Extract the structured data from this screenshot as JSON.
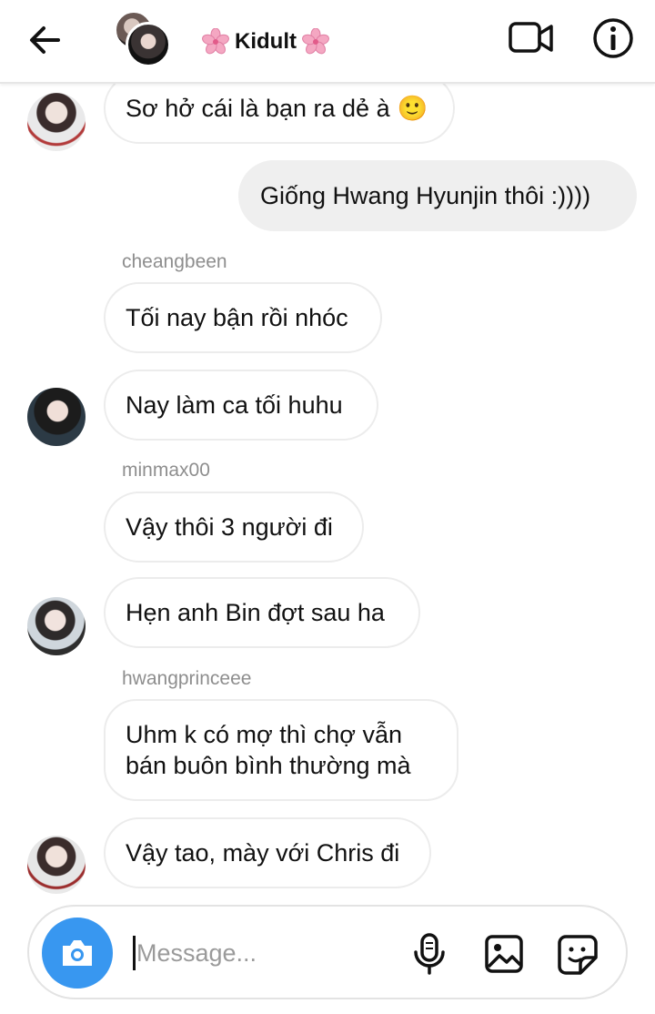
{
  "header": {
    "title": "Kidult",
    "icons": {
      "back": "arrow-left-icon",
      "title_decoration": "cherry-blossom-icon",
      "video": "video-camera-icon",
      "info": "info-icon"
    }
  },
  "messages": [
    {
      "side": "left",
      "text": "Sơ hở cái là bạn ra dẻ à",
      "emoji": "🙂"
    },
    {
      "side": "right",
      "text": "Giống Hwang Hyunjin thôi :))))"
    },
    {
      "side": "left",
      "sender": "cheangbeen",
      "text": "Tối nay bận rồi nhóc"
    },
    {
      "side": "left",
      "text": "Nay làm ca tối huhu"
    },
    {
      "side": "left",
      "sender": "minmax00",
      "text": "Vậy thôi 3 người đi"
    },
    {
      "side": "left",
      "text": "Hẹn anh Bin đợt sau ha"
    },
    {
      "side": "left",
      "sender": "hwangprinceee",
      "text": "Uhm k có mợ thì chợ vẫn bán buôn bình thường mà"
    },
    {
      "side": "left",
      "text": "Vậy tao, mày với Chris đi"
    }
  ],
  "composer": {
    "placeholder": "Message...",
    "value": "",
    "icons": [
      "camera-icon",
      "microphone-icon",
      "image-icon",
      "sticker-icon"
    ]
  },
  "colors": {
    "accent": "#3897f0",
    "my_bubble": "#efefef",
    "sender_text": "#8e8e8e"
  }
}
